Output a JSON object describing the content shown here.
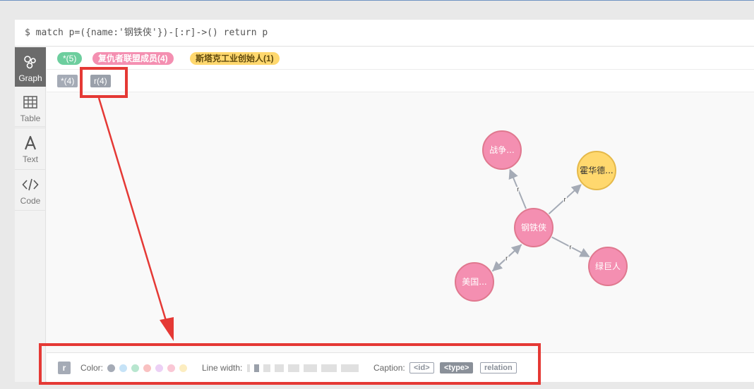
{
  "query": {
    "text": "$ match p=({name:'钢铁侠'})-[:r]->() return p"
  },
  "sidebar": {
    "items": [
      {
        "label": "Graph",
        "icon": "graph-icon",
        "active": true
      },
      {
        "label": "Table",
        "icon": "table-icon",
        "active": false
      },
      {
        "label": "Text",
        "icon": "text-icon",
        "active": false
      },
      {
        "label": "Code",
        "icon": "code-icon",
        "active": false
      }
    ]
  },
  "node_labels": [
    {
      "label": "*(5)",
      "color": "#68bdf6",
      "bg": "#6dce9e",
      "fg": "#ffffff"
    },
    {
      "label": "复仇者联盟成员(4)",
      "bg": "#f16667",
      "fg": "#ffffff"
    },
    {
      "label": "斯塔克工业创始人(1)",
      "bg": "#ffd86e",
      "fg": "#604a0e"
    }
  ],
  "rel_types": [
    {
      "label": "*(4)"
    },
    {
      "label": "r(4)"
    }
  ],
  "graph": {
    "nodes": [
      {
        "id": "ironman",
        "caption": "钢铁侠",
        "color": "#f48fb1",
        "border": "#e0788f"
      },
      {
        "id": "war",
        "caption": "战争...",
        "color": "#f48fb1",
        "border": "#e0788f"
      },
      {
        "id": "howard",
        "caption": "霍华德...",
        "color": "#ffd86e",
        "border": "#e5b94a",
        "fg": "#333333"
      },
      {
        "id": "hulk",
        "caption": "绿巨人",
        "color": "#f48fb1",
        "border": "#e0788f"
      },
      {
        "id": "cap",
        "caption": "美国...",
        "color": "#f48fb1",
        "border": "#e0788f"
      }
    ],
    "edges": [
      {
        "from": "ironman",
        "to": "war",
        "label": "r"
      },
      {
        "from": "ironman",
        "to": "howard",
        "label": "r"
      },
      {
        "from": "ironman",
        "to": "hulk",
        "label": "r"
      },
      {
        "from": "ironman",
        "to": "cap",
        "label": "r"
      },
      {
        "from": "cap",
        "to": "ironman",
        "label": "r"
      }
    ]
  },
  "inspector": {
    "badge": "r",
    "color_label": "Color:",
    "colors": [
      "#a5abb6",
      "#c6e3f7",
      "#b8e6cf",
      "#f9c1c1",
      "#ecd0f5",
      "#fac7d5",
      "#fcedc0"
    ],
    "linewidth_label": "Line width:",
    "caption_label": "Caption:",
    "caption_options": [
      {
        "label": "<id>",
        "selected": false
      },
      {
        "label": "<type>",
        "selected": true
      },
      {
        "label": "relation",
        "selected": false
      }
    ]
  },
  "annotation": {
    "color": "#e53935"
  }
}
